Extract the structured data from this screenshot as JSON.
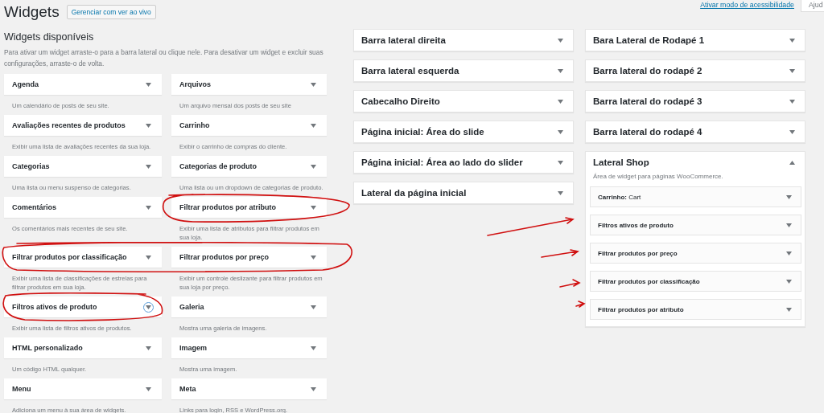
{
  "header": {
    "title": "Widgets",
    "manage_button": "Gerenciar com ver ao vivo",
    "accessibility_link": "Ativar modo de acessibilidade",
    "help_tab": "Ajud"
  },
  "available": {
    "title": "Widgets disponíveis",
    "description": "Para ativar um widget arraste-o para a barra lateral ou clique nele. Para desativar um widget e excluir suas configurações, arraste-o de volta.",
    "widgets": [
      {
        "title": "Agenda",
        "description": "Um calendário de posts de seu site.",
        "focused": false
      },
      {
        "title": "Arquivos",
        "description": "Um arquivo mensal dos posts de seu site",
        "focused": false
      },
      {
        "title": "Avaliações recentes de produtos",
        "description": "Exibir uma lista de avaliações recentes da sua loja.",
        "focused": false
      },
      {
        "title": "Carrinho",
        "description": "Exibir o carrinho de compras do cliente.",
        "focused": false
      },
      {
        "title": "Categorias",
        "description": "Uma lista ou menu suspenso de categorias.",
        "focused": false
      },
      {
        "title": "Categorias de produto",
        "description": "Uma lista ou um dropdown de categorias de produto.",
        "focused": false
      },
      {
        "title": "Comentários",
        "description": "Os comentários mais recentes de seu site.",
        "focused": false
      },
      {
        "title": "Filtrar produtos por atributo",
        "description": "Exibir uma lista de atributos para filtrar produtos em sua loja.",
        "focused": false
      },
      {
        "title": "Filtrar produtos por classificação",
        "description": "Exibir uma lista de classificações de estrelas para filtrar produtos em sua loja.",
        "focused": false
      },
      {
        "title": "Filtrar produtos por preço",
        "description": "Exibir um controle deslizante para filtrar produtos em sua loja por preço.",
        "focused": false
      },
      {
        "title": "Filtros ativos de produto",
        "description": "Exibir uma lista de filtros ativos de produtos.",
        "focused": true
      },
      {
        "title": "Galeria",
        "description": "Mostra uma galeria de imagens.",
        "focused": false
      },
      {
        "title": "HTML personalizado",
        "description": "Um código HTML qualquer.",
        "focused": false
      },
      {
        "title": "Imagem",
        "description": "Mostra uma imagem.",
        "focused": false
      },
      {
        "title": "Menu",
        "description": "Adiciona um menu à sua área de widgets.",
        "focused": false
      },
      {
        "title": "Meta",
        "description": "Links para login, RSS e WordPress.org.",
        "focused": false
      }
    ]
  },
  "sidebars_left": [
    {
      "title": "Barra lateral direita",
      "expanded": false
    },
    {
      "title": "Barra lateral esquerda",
      "expanded": false
    },
    {
      "title": "Cabecalho Direito",
      "expanded": false
    },
    {
      "title": "Página inicial: Área do slide",
      "expanded": false
    },
    {
      "title": "Página inicial: Área ao lado do slider",
      "expanded": false
    },
    {
      "title": "Lateral da página inicial",
      "expanded": false
    }
  ],
  "sidebars_right": [
    {
      "title": "Bara Lateral de Rodapé 1",
      "expanded": false
    },
    {
      "title": "Barra lateral do rodapé 2",
      "expanded": false
    },
    {
      "title": "Barra lateral do rodapé 3",
      "expanded": false
    },
    {
      "title": "Barra lateral do rodapé 4",
      "expanded": false
    },
    {
      "title": "Lateral Shop",
      "expanded": true,
      "description": "Área de widget para páginas WooCommerce.",
      "widgets": [
        {
          "title": "**Carrinho:** Cart"
        },
        {
          "title": "**Filtros ativos de produto**"
        },
        {
          "title": "**Filtrar produtos por preço**"
        },
        {
          "title": "**Filtrar produtos por classificação**"
        },
        {
          "title": "**Filtrar produtos por atributo**"
        }
      ]
    }
  ]
}
